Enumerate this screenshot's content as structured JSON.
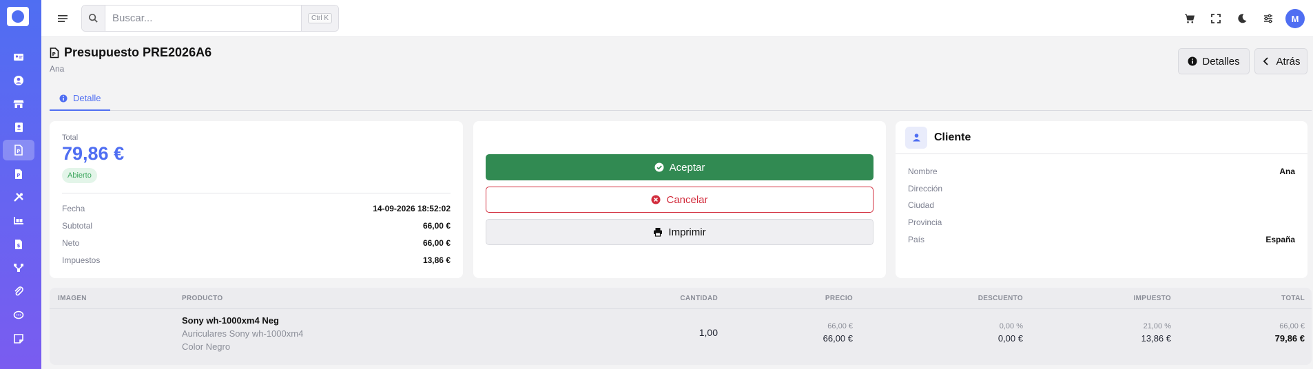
{
  "colors": {
    "accent": "#4f6ef2",
    "accept": "#318a52",
    "cancel": "#d22d3d",
    "badge_bg": "#e3f5e9",
    "badge_text": "#3aa55c"
  },
  "sidebar": {
    "logo": "app-logo",
    "items": [
      {
        "icon": "id-card-icon",
        "active": false
      },
      {
        "icon": "user-circle-icon",
        "active": false
      },
      {
        "icon": "store-icon",
        "active": false
      },
      {
        "icon": "contact-book-icon",
        "active": false
      },
      {
        "icon": "quote-document-icon",
        "active": true
      },
      {
        "icon": "order-document-icon",
        "active": false
      },
      {
        "icon": "tools-icon",
        "active": false
      },
      {
        "icon": "warehouse-icon",
        "active": false
      },
      {
        "icon": "invoice-icon",
        "active": false
      },
      {
        "icon": "network-icon",
        "active": false
      },
      {
        "icon": "paperclip-icon",
        "active": false
      },
      {
        "icon": "chat-icon",
        "active": false
      },
      {
        "icon": "note-icon",
        "active": false
      }
    ]
  },
  "topbar": {
    "search": {
      "placeholder": "Buscar...",
      "value": "",
      "shortcut": "Ctrl K"
    },
    "icons": [
      "cart-icon",
      "fullscreen-icon",
      "moon-icon",
      "sliders-icon"
    ],
    "avatar": "M"
  },
  "header": {
    "title": "Presupuesto PRE2026A6",
    "subtitle": "Ana",
    "details_label": "Detalles",
    "back_label": "Atrás"
  },
  "tabs": [
    {
      "label": "Detalle",
      "active": true
    }
  ],
  "summary": {
    "total_label": "Total",
    "total_value": "79,86 €",
    "status": "Abierto",
    "rows": [
      {
        "key": "Fecha",
        "value": "14-09-2026 18:52:02"
      },
      {
        "key": "Subtotal",
        "value": "66,00 €"
      },
      {
        "key": "Neto",
        "value": "66,00 €"
      },
      {
        "key": "Impuestos",
        "value": "13,86 €"
      }
    ]
  },
  "actions": {
    "accept": "Aceptar",
    "cancel": "Cancelar",
    "print": "Imprimir"
  },
  "client": {
    "title": "Cliente",
    "rows": [
      {
        "key": "Nombre",
        "value": "Ana"
      },
      {
        "key": "Dirección",
        "value": ""
      },
      {
        "key": "Ciudad",
        "value": ""
      },
      {
        "key": "Provincia",
        "value": ""
      },
      {
        "key": "País",
        "value": "España"
      }
    ]
  },
  "table": {
    "headers": [
      "IMAGEN",
      "PRODUCTO",
      "CANTIDAD",
      "PRECIO",
      "DESCUENTO",
      "IMPUESTO",
      "TOTAL"
    ],
    "rows": [
      {
        "name": "Sony wh-1000xm4 Neg",
        "description": "Auriculares Sony wh-1000xm4",
        "variant": "Color Negro",
        "quantity": "1,00",
        "price_unit": "66,00 €",
        "price": "66,00 €",
        "discount_pct": "0,00 %",
        "discount": "0,00 €",
        "tax_pct": "21,00 %",
        "tax": "13,86 €",
        "total_unit": "66,00 €",
        "total": "79,86 €"
      }
    ]
  }
}
